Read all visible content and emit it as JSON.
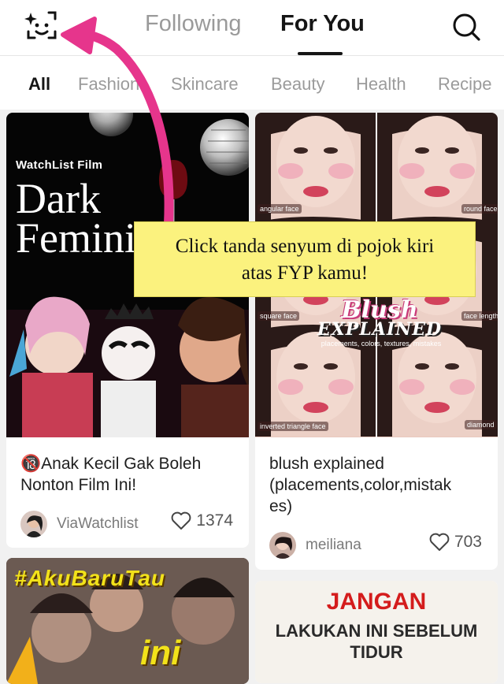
{
  "header": {
    "tabs": [
      {
        "label": "Following",
        "active": false
      },
      {
        "label": "For You",
        "active": true
      }
    ]
  },
  "categories": [
    {
      "label": "All",
      "active": true
    },
    {
      "label": "Fashion",
      "active": false
    },
    {
      "label": "Skincare",
      "active": false
    },
    {
      "label": "Beauty",
      "active": false
    },
    {
      "label": "Health",
      "active": false
    },
    {
      "label": "Recipe",
      "active": false
    }
  ],
  "posts": [
    {
      "title": "🔞Anak Kecil Gak Boleh Nonton Film Ini!",
      "author": "ViaWatchlist",
      "likes": "1374",
      "image_text": {
        "brand": "WatchList Film",
        "headline_1": "Dark",
        "headline_2": "Femini"
      }
    },
    {
      "title": "blush explained (placements,color,mistakes)",
      "title_lines": [
        "blush explained",
        "(placements,color,mistak",
        "es)"
      ],
      "author": "meiliana",
      "likes": "703",
      "image_text": {
        "labels": [
          "angular face",
          "round face",
          "square face",
          "face length",
          "inverted triangle face",
          "diamond"
        ],
        "title_1": "Blush",
        "title_2": "EXPLAINED",
        "subtitle": "placements, colors, textures, mistakes"
      }
    },
    {
      "image_text": {
        "header": "#AkuBaruTau",
        "big": "ini"
      }
    },
    {
      "image_text": {
        "line_1": "JANGAN",
        "line_2": "LAKUKAN INI SEBELUM",
        "line_3": "TIDUR"
      }
    }
  ],
  "callout": {
    "line_1": "Click tanda senyum di pojok kiri",
    "line_2": "atas FYP kamu!"
  },
  "colors": {
    "arrow": "#e6358c",
    "callout_bg": "#fbf27e",
    "active_text": "#151515",
    "inactive_text": "#9a9a9a"
  }
}
